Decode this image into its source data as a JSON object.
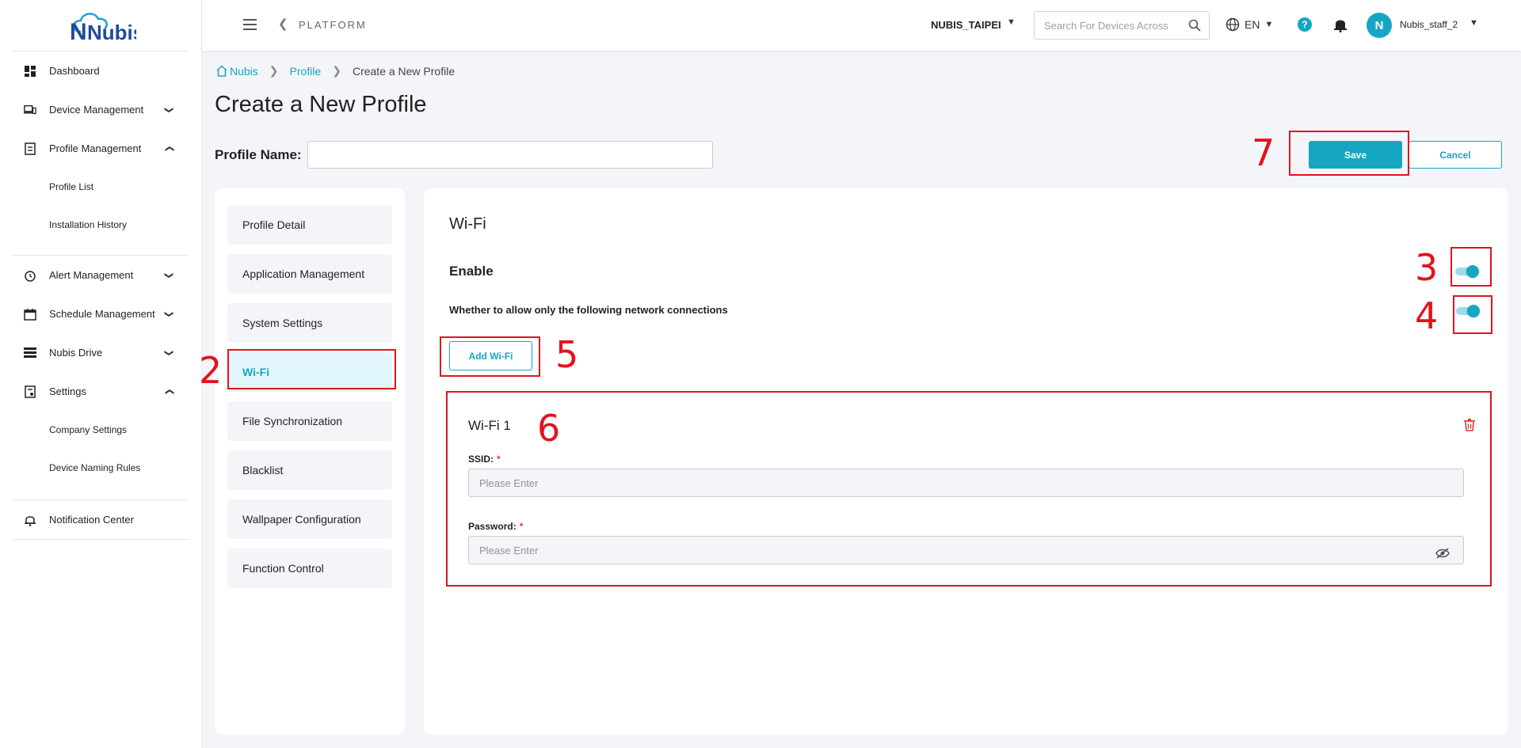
{
  "app": {
    "logo": "Nubis"
  },
  "sidebar": {
    "items": [
      {
        "label": "Dashboard",
        "icon": "dashboard-icon"
      },
      {
        "label": "Device Management",
        "icon": "devices-icon",
        "chevron": "down"
      },
      {
        "label": "Profile Management",
        "icon": "profile-icon",
        "chevron": "up"
      },
      {
        "label": "Profile List",
        "sub": true
      },
      {
        "label": "Installation History",
        "sub": true
      },
      {
        "label": "Alert Management",
        "icon": "alarm-clock-icon",
        "chevron": "down"
      },
      {
        "label": "Schedule Management",
        "icon": "calendar-icon",
        "chevron": "down"
      },
      {
        "label": "Nubis Drive",
        "icon": "drive-icon",
        "chevron": "down"
      },
      {
        "label": "Settings",
        "icon": "settings-doc-icon",
        "chevron": "up"
      },
      {
        "label": "Company Settings",
        "sub": true
      },
      {
        "label": "Device Naming Rules",
        "sub": true
      },
      {
        "label": "Notification Center",
        "icon": "bell-outline-icon"
      }
    ]
  },
  "header": {
    "platform": "PLATFORM",
    "org": "NUBIS_TAIPEI",
    "search_placeholder": "Search For Devices Across",
    "lang": "EN",
    "help": "?",
    "avatar_initial": "N",
    "user": "Nubis_staff_2"
  },
  "breadcrumb": {
    "home": "Nubis",
    "section": "Profile",
    "current": "Create a New Profile"
  },
  "page": {
    "title": "Create a New Profile",
    "profile_name_label": "Profile Name:",
    "profile_name_value": "",
    "save": "Save",
    "cancel": "Cancel"
  },
  "menu": {
    "items": [
      "Profile Detail",
      "Application Management",
      "System Settings",
      "Wi-Fi",
      "File Synchronization",
      "Blacklist",
      "Wallpaper Configuration",
      "Function Control"
    ],
    "active": "Wi-Fi"
  },
  "wifi": {
    "section_title": "Wi-Fi",
    "enable_label": "Enable",
    "enable_on": true,
    "allow_label": "Whether to allow only the following network connections",
    "allow_on": true,
    "add_button": "Add Wi-Fi",
    "card_title": "Wi-Fi 1",
    "ssid_label": "SSID:",
    "ssid_placeholder": "Please Enter",
    "password_label": "Password:",
    "password_placeholder": "Please Enter",
    "required_mark": "*"
  },
  "annotations": [
    "2",
    "3",
    "4",
    "5",
    "6",
    "7"
  ],
  "colors": {
    "accent": "#16a6c4",
    "annotation": "#e0141e",
    "brand": "#1f4b9c",
    "required": "#e53935"
  }
}
